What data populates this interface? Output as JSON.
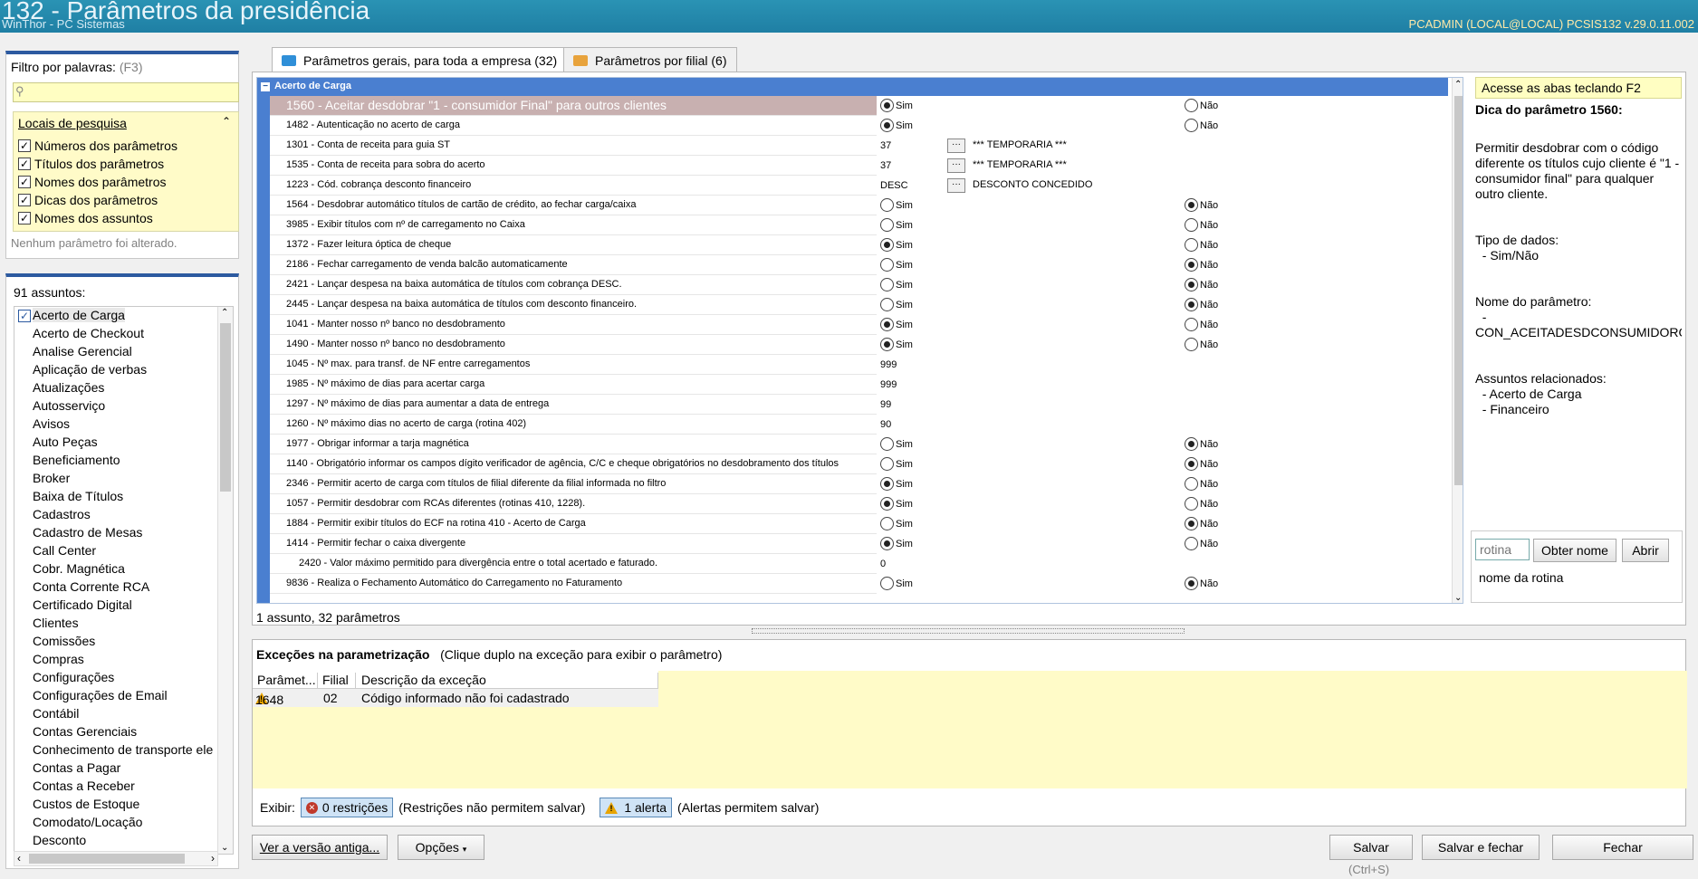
{
  "titlebar": {
    "title": "132 - Parâmetros da presidência",
    "subtitle": "WinThor - PC Sistemas",
    "info": "PCADMIN (LOCAL@LOCAL)  PCSIS132  v.29.0.11.002"
  },
  "filter": {
    "label": "Filtro por palavras:",
    "shortcut": "(F3)",
    "search_value": "",
    "locais_title": "Locais de pesquisa",
    "options": [
      {
        "label": "Números dos parâmetros",
        "checked": true
      },
      {
        "label": "Títulos dos parâmetros",
        "checked": true
      },
      {
        "label": "Nomes dos parâmetros",
        "checked": true
      },
      {
        "label": "Dicas dos parâmetros",
        "checked": true
      },
      {
        "label": "Nomes dos assuntos",
        "checked": true
      }
    ],
    "status": "Nenhum parâmetro foi alterado."
  },
  "subjects": {
    "count_label": "91 assuntos:",
    "items": [
      "Acerto de Carga",
      "Acerto de Checkout",
      "Analise Gerencial",
      "Aplicação de verbas",
      "Atualizações",
      "Autosserviço",
      "Avisos",
      "Auto Peças",
      "Beneficiamento",
      "Broker",
      "Baixa de Títulos",
      "Cadastros",
      "Cadastro de Mesas",
      "Call Center",
      "Cobr. Magnética",
      "Conta Corrente RCA",
      "Certificado Digital",
      "Clientes",
      "Comissões",
      "Compras",
      "Configurações",
      "Configurações de Email",
      "Contábil",
      "Contas Gerenciais",
      "Conhecimento de transporte ele",
      "Contas a Pagar",
      "Contas a Receber",
      "Custos de Estoque",
      "Comodato/Locação",
      "Desconto"
    ]
  },
  "tabs": [
    {
      "label": "Parâmetros gerais, para toda a empresa  (32)",
      "color": "#2f8fd8"
    },
    {
      "label": "Parâmetros por filial  (6)",
      "color": "#e8a33c"
    }
  ],
  "grid": {
    "group": "Acerto de Carga",
    "yes": "Sim",
    "no": "Não",
    "rows": [
      {
        "name": "1560 - Aceitar desdobrar \"1 - consumidor Final\" para outros clientes",
        "type": "bool",
        "value": "sim"
      },
      {
        "name": "1482 - Autenticação no acerto de carga",
        "type": "bool",
        "value": "sim"
      },
      {
        "name": "1301 - Conta de receita para guia ST",
        "type": "lookup",
        "value": "37",
        "desc": "*** TEMPORARIA ***"
      },
      {
        "name": "1535 - Conta de receita para sobra do acerto",
        "type": "lookup",
        "value": "37",
        "desc": "*** TEMPORARIA ***"
      },
      {
        "name": "1223 - Cód. cobrança desconto financeiro",
        "type": "lookup",
        "value": "DESC",
        "desc": "DESCONTO CONCEDIDO"
      },
      {
        "name": "1564 - Desdobrar automático títulos de cartão de crédito, ao fechar carga/caixa",
        "type": "bool",
        "value": "nao"
      },
      {
        "name": "3985 - Exibir títulos com nº de carregamento no Caixa",
        "type": "bool",
        "value": "none"
      },
      {
        "name": "1372 - Fazer leitura óptica de cheque",
        "type": "bool",
        "value": "sim"
      },
      {
        "name": "2186 - Fechar carregamento de venda balcão automaticamente",
        "type": "bool",
        "value": "nao"
      },
      {
        "name": "2421 - Lançar despesa na baixa automática de títulos com cobrança DESC.",
        "type": "bool",
        "value": "nao"
      },
      {
        "name": "2445 - Lançar despesa na baixa automática de títulos com desconto financeiro.",
        "type": "bool",
        "value": "nao"
      },
      {
        "name": "1041 - Manter nosso nº banco no desdobramento",
        "type": "bool",
        "value": "sim"
      },
      {
        "name": "1490 - Manter nosso nº banco no desdobramento",
        "type": "bool",
        "value": "sim"
      },
      {
        "name": "1045 - Nº max. para transf. de NF entre carregamentos",
        "type": "text",
        "value": "999"
      },
      {
        "name": "1985 - Nº máximo de dias para acertar carga",
        "type": "text",
        "value": "999"
      },
      {
        "name": "1297 - Nº máximo de dias para aumentar a data de entrega",
        "type": "text",
        "value": "99"
      },
      {
        "name": "1260 - Nº máximo dias no acerto de carga (rotina 402)",
        "type": "text",
        "value": "90"
      },
      {
        "name": "1977 - Obrigar informar a tarja magnética",
        "type": "bool",
        "value": "nao"
      },
      {
        "name": "1140 - Obrigatório informar os campos dígito verificador de agência, C/C e cheque obrigatórios no desdobramento dos títulos",
        "type": "bool",
        "value": "nao"
      },
      {
        "name": "2346 - Permitir acerto de carga com títulos de filial diferente da filial informada no filtro",
        "type": "bool",
        "value": "sim"
      },
      {
        "name": "1057 - Permitir desdobrar com RCAs diferentes (rotinas 410, 1228).",
        "type": "bool",
        "value": "sim"
      },
      {
        "name": "1884 - Permitir exibir títulos do ECF na rotina 410 - Acerto de Carga",
        "type": "bool",
        "value": "nao"
      },
      {
        "name": "1414 - Permitir fechar o caixa divergente",
        "type": "bool",
        "value": "sim"
      },
      {
        "name": "2420 - Valor máximo permitido para divergência entre o total acertado e faturado.",
        "type": "text",
        "value": "0",
        "sub": true
      },
      {
        "name": "9836 - Realiza o Fechamento Automático do Carregamento no Faturamento",
        "type": "bool",
        "value": "nao"
      }
    ],
    "status": "1 assunto, 32 parâmetros"
  },
  "tip": {
    "hint": "Acesse as abas teclando F2",
    "title": "Dica do parâmetro 1560:",
    "body": "Permitir desdobrar com o código diferente os títulos cujo cliente é \"1 - consumidor final\" para qualquer outro cliente.\n\n\nTipo de dados:\n  - Sim/Não\n\n\nNome do parâmetro:\n  -\nCON_ACEITADESDCONSUMIDOROUT\n\n\nAssuntos relacionados:\n  - Acerto de Carga\n  - Financeiro"
  },
  "rotina": {
    "placeholder": "rotina",
    "get_name": "Obter nome",
    "open": "Abrir",
    "name_label": "nome da rotina"
  },
  "exceptions": {
    "title": "Exceções na parametrização",
    "subtitle": "(Clique duplo na exceção para exibir o parâmetro)",
    "columns": [
      "Parâmet...",
      "Filial",
      "Descrição da exceção"
    ],
    "rows": [
      {
        "param": "1648",
        "filial": "02",
        "desc": "Código informado não foi cadastrado"
      }
    ],
    "show_label": "Exibir:",
    "restrictions": "0 restrições",
    "restrictions_note": "(Restrições não permitem salvar)",
    "alerts": "1 alerta",
    "alerts_note": "(Alertas permitem salvar)"
  },
  "footer": {
    "old_version": "Ver a versão antiga...",
    "options": "Opções",
    "save": "Salvar",
    "save_shortcut": "(Ctrl+S)",
    "save_close": "Salvar e fechar",
    "close": "Fechar"
  }
}
